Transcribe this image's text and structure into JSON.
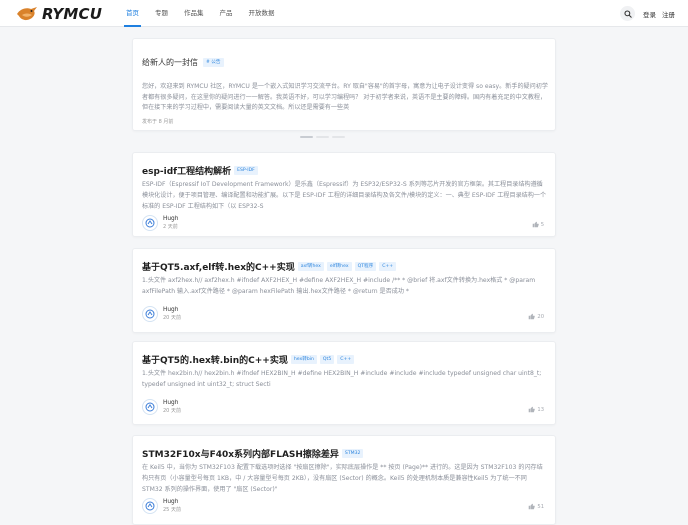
{
  "app": {
    "logo_text": "RYMCU",
    "nav": [
      "首页",
      "专题",
      "作品集",
      "产品",
      "开放数据"
    ],
    "login_label": "登录",
    "register_label": "注册",
    "colors": {
      "accent": "#1e7fe0",
      "tag_bg": "#e8f2fd",
      "tag_text": "#2e86de"
    }
  },
  "banner": {
    "title": "给新人的一封信",
    "tag": "# 公告",
    "body": "您好，欢迎来到 RYMCU 社区，RYMCU 是一个嵌入式知识学习交流平台。RY 取自\"容易\"的首字母，寓意为让电子设计变得 so easy。新手的疑问初学者都有很多疑问，在这里你的疑问进行一一解答。我英语不好，可以学习编程吗？ 对于初学者来说，英语不是主要的障碍。国内有着充足的中文教程，但在接下来的学习过程中，需要阅读大量的英文文档。所以还是需要有一些英",
    "time": "发布于 8 月前"
  },
  "posts": [
    {
      "title": "esp-idf工程结构解析",
      "tags": [
        "ESP-IDF"
      ],
      "excerpt": "ESP-IDF（Espressif IoT Development Framework）是乐鑫（Espressif）为 ESP32/ESP32-S 系列等芯片开发的官方框架。其工程目录结构遵循模块化设计，便于项目管理、编译配置和功能扩展。以下是 ESP-IDF 工程的详细目录结构及各文件/模块的定义：一、典型 ESP-IDF 工程目录结构一个标准的 ESP-IDF 工程结构如下（以 ESP32-S",
      "author": "Hugh",
      "time": "2 天前",
      "likes": "5"
    },
    {
      "title": "基于QT5.axf,elf转.hex的C++实现",
      "tags": [
        "axf转hex",
        "elf转hex",
        "QT程序",
        "C++"
      ],
      "excerpt": "1.头文件 axf2hex.h// axf2hex.h #ifndef AXF2HEX_H #define AXF2HEX_H #include /** * @brief 将.axf文件转换为.hex格式 * @param axfFilePath 输入.axf文件路径 * @param hexFilePath 输出.hex文件路径 * @return 是否成功 *",
      "author": "Hugh",
      "time": "20 天前",
      "likes": "20"
    },
    {
      "title": "基于QT5的.hex转.bin的C++实现",
      "tags": [
        "hex转bin",
        "Qt5",
        "C++"
      ],
      "excerpt": "1.头文件 hex2bin.h// hex2bin.h #ifndef HEX2BIN_H #define HEX2BIN_H #include #include #include typedef unsigned char uint8_t; typedef unsigned int uint32_t; struct Secti",
      "author": "Hugh",
      "time": "20 天前",
      "likes": "13"
    },
    {
      "title": "STM32F10x与F40x系列内部FLASH擦除差异",
      "tags": [
        "STM32"
      ],
      "excerpt": "在 Keil5 中，当你为 STM32F103 配置下载选项时选择 \"按扇区擦除\"，实际底层操作是 ** 按页 (Page)** 进行的。这是因为 STM32F103 的闪存结构只有页（小容量型号每页 1KB，中 / 大容量型号每页 2KB），没有扇区 (Sector) 的概念。Keil5 的处理机制本质是兼容性Keil5 为了统一不同 STM32 系列的操作界面，使用了 \"扇区 (Sector)\"",
      "author": "Hugh",
      "time": "25 天前",
      "likes": "51"
    }
  ]
}
